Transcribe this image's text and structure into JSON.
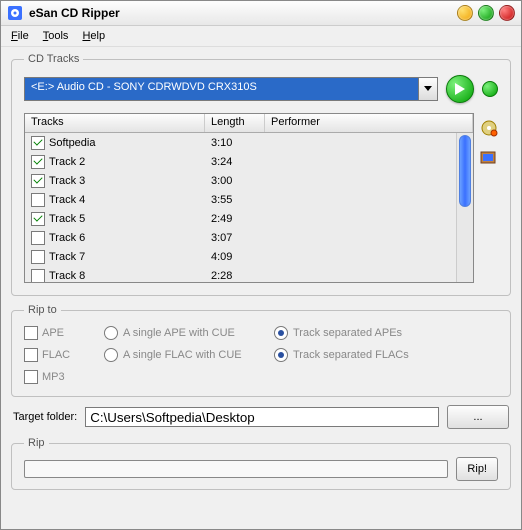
{
  "app": {
    "title": "eSan CD Ripper"
  },
  "menu": {
    "file": "File",
    "tools": "Tools",
    "help": "Help"
  },
  "groups": {
    "tracks": "CD Tracks",
    "ripto": "Rip to",
    "rip": "Rip"
  },
  "drive": {
    "selected": "<E:> Audio CD - SONY    CDRWDVD CRX310S"
  },
  "columns": {
    "tracks": "Tracks",
    "length": "Length",
    "performer": "Performer"
  },
  "tracks": [
    {
      "checked": true,
      "name": "Softpedia",
      "length": "3:10",
      "performer": ""
    },
    {
      "checked": true,
      "name": "Track 2",
      "length": "3:24",
      "performer": ""
    },
    {
      "checked": true,
      "name": "Track 3",
      "length": "3:00",
      "performer": ""
    },
    {
      "checked": false,
      "name": "Track 4",
      "length": "3:55",
      "performer": ""
    },
    {
      "checked": true,
      "name": "Track 5",
      "length": "2:49",
      "performer": ""
    },
    {
      "checked": false,
      "name": "Track 6",
      "length": "3:07",
      "performer": ""
    },
    {
      "checked": false,
      "name": "Track 7",
      "length": "4:09",
      "performer": ""
    },
    {
      "checked": false,
      "name": "Track 8",
      "length": "2:28",
      "performer": ""
    }
  ],
  "ripto": {
    "ape": {
      "label": "APE",
      "single": "A single APE with CUE",
      "sep": "Track separated APEs"
    },
    "flac": {
      "label": "FLAC",
      "single": "A single FLAC with CUE",
      "sep": "Track separated FLACs"
    },
    "mp3": {
      "label": "MP3"
    }
  },
  "target": {
    "label": "Target folder:",
    "value": "C:\\Users\\Softpedia\\Desktop",
    "browse": "..."
  },
  "rip": {
    "button": "Rip!"
  }
}
